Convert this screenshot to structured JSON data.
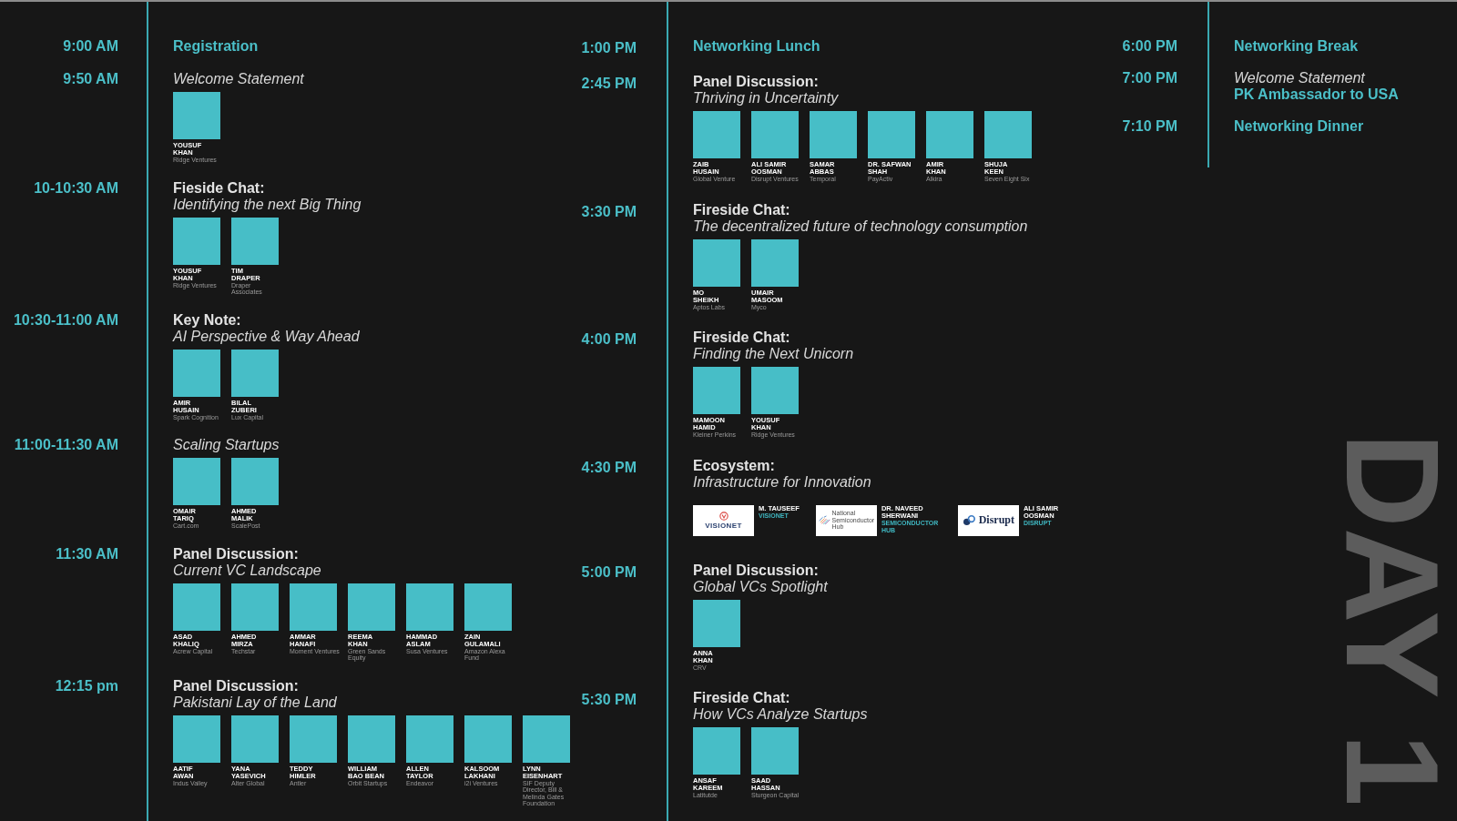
{
  "schedule_columns": [
    {
      "events": [
        {
          "kind": "break",
          "time": "9:00 AM",
          "title": "Registration"
        },
        {
          "kind": "session",
          "time": "9:50 AM",
          "title": "Welcome Statement",
          "speakers": [
            {
              "name": "YOUSUF\nKHAN",
              "org": "Ridge Ventures"
            }
          ]
        },
        {
          "kind": "session",
          "time": "10-10:30 AM",
          "label": "Fieside Chat:",
          "title": "Identifying the next Big Thing",
          "speakers": [
            {
              "name": "YOUSUF\nKHAN",
              "org": "Ridge Ventures"
            },
            {
              "name": "TIM\nDRAPER",
              "org": "Draper Associates"
            }
          ]
        },
        {
          "kind": "session",
          "time": "10:30-11:00 AM",
          "label": "Key Note:",
          "title": "AI Perspective & Way Ahead",
          "speakers": [
            {
              "name": "AMIR\nHUSAIN",
              "org": "Spark Cognition"
            },
            {
              "name": "BILAL\nZUBERI",
              "org": "Lux Capital"
            }
          ]
        },
        {
          "kind": "session",
          "time": "11:00-11:30 AM",
          "title": "Scaling Startups",
          "speakers": [
            {
              "name": "OMAIR\nTARIQ",
              "org": "Cart.com"
            },
            {
              "name": "AHMED\nMALIK",
              "org": "ScalePost"
            }
          ]
        },
        {
          "kind": "session",
          "time": "11:30 AM",
          "label": "Panel Discussion:",
          "title": "Current VC Landscape",
          "speakers": [
            {
              "name": "ASAD\nKHALIQ",
              "org": "Acrew Capital"
            },
            {
              "name": "AHMED\nMIRZA",
              "org": "Techstar"
            },
            {
              "name": "AMMAR\nHANAFI",
              "org": "Moment Ventures"
            },
            {
              "name": "REEMA\nKHAN",
              "org": "Green Sands Equity"
            },
            {
              "name": "HAMMAD\nASLAM",
              "org": "Susa Ventures"
            },
            {
              "name": "ZAIN\nGULAMALI",
              "org": "Amazon Alexa Fund"
            }
          ]
        },
        {
          "kind": "session",
          "time": "12:15 pm",
          "label": "Panel Discussion:",
          "title": "Pakistani Lay of the Land",
          "speakers": [
            {
              "name": "AATIF\nAWAN",
              "org": "Indus Valley"
            },
            {
              "name": "YANA\nYASEVICH",
              "org": "Alter Global"
            },
            {
              "name": "TEDDY\nHIMLER",
              "org": "Antler"
            },
            {
              "name": "WILLIAM\nBAO BEAN",
              "org": "Orbit Startups"
            },
            {
              "name": "ALLEN\nTAYLOR",
              "org": "Endeavor"
            },
            {
              "name": "KALSOOM\nLAKHANI",
              "org": "i2i Ventures"
            },
            {
              "name": "LYNN\nEISENHART",
              "org": "SIF Deputy Director, Bill & Melinda Gates Foundation"
            }
          ]
        }
      ]
    },
    {
      "events": [
        {
          "kind": "break",
          "time": "1:00 PM",
          "title": "Networking Lunch"
        },
        {
          "kind": "session",
          "time": "2:45 PM",
          "label": "Panel Discussion:",
          "title": "Thriving in Uncertainty",
          "speakers": [
            {
              "name": "ZAIB\nHUSAIN",
              "org": "Global Venture"
            },
            {
              "name": "ALI SAMIR\nOOSMAN",
              "org": "Disrupt Ventures"
            },
            {
              "name": "SAMAR\nABBAS",
              "org": "Temporal"
            },
            {
              "name": "DR. SAFWAN\nSHAH",
              "org": "PayActiv"
            },
            {
              "name": "AMIR\nKHAN",
              "org": "Alkira"
            },
            {
              "name": "SHUJA\nKEEN",
              "org": "Seven Eight Six"
            }
          ]
        },
        {
          "kind": "session",
          "time": "3:30 PM",
          "label": "Fireside Chat:",
          "title": "The decentralized future of technology consumption",
          "speakers": [
            {
              "name": "MO\nSHEIKH",
              "org": "Aptos Labs"
            },
            {
              "name": "UMAIR\nMASOOM",
              "org": "Myco"
            }
          ]
        },
        {
          "kind": "session",
          "time": "4:00 PM",
          "label": "Fireside Chat:",
          "title": "Finding the Next Unicorn",
          "speakers": [
            {
              "name": "MAMOON\nHAMID",
              "org": "Kleiner Perkins"
            },
            {
              "name": "YOUSUF\nKHAN",
              "org": "Ridge Ventures"
            }
          ]
        },
        {
          "kind": "showcase",
          "time": "4:30 PM",
          "label": "Ecosystem:",
          "title": "Infrastructure for Innovation",
          "partners": [
            {
              "name": "M. TAUSEEF",
              "org": "VISIONET",
              "logo": {
                "kind": "ring",
                "text": "VISIONET"
              }
            },
            {
              "name": "DR. NAVEED\nSHERWANI",
              "org": "SEMICONDUCTOR HUB",
              "logo": {
                "kind": "stripes",
                "text": "National\nSemiconductor\nHub"
              }
            },
            {
              "name": "ALI SAMIR\nOOSMAN",
              "org": "DISRUPT",
              "logo": {
                "kind": "circles",
                "text": "Disrupt"
              }
            }
          ]
        },
        {
          "kind": "session",
          "time": "5:00 PM",
          "label": "Panel Discussion:",
          "title": "Global VCs Spotlight",
          "speakers": [
            {
              "name": "ANNA\nKHAN",
              "org": "CRV"
            }
          ]
        },
        {
          "kind": "session",
          "time": "5:30 PM",
          "label": "Fireside Chat:",
          "title": "How VCs Analyze Startups",
          "speakers": [
            {
              "name": "ANSAF\nKAREEM",
              "org": "Latitutde"
            },
            {
              "name": "SAAD\nHASSAN",
              "org": "Sturgeon Capital"
            }
          ]
        }
      ]
    },
    {
      "events": [
        {
          "kind": "break",
          "time": "6:00 PM",
          "title": "Networking Break"
        },
        {
          "kind": "session",
          "time": "7:00 PM",
          "title": "Welcome Statement",
          "host": "PK Ambassador to USA"
        },
        {
          "kind": "break",
          "time": "7:10 PM",
          "title": "Networking Dinner"
        }
      ]
    }
  ],
  "day_label": "DAY 1"
}
